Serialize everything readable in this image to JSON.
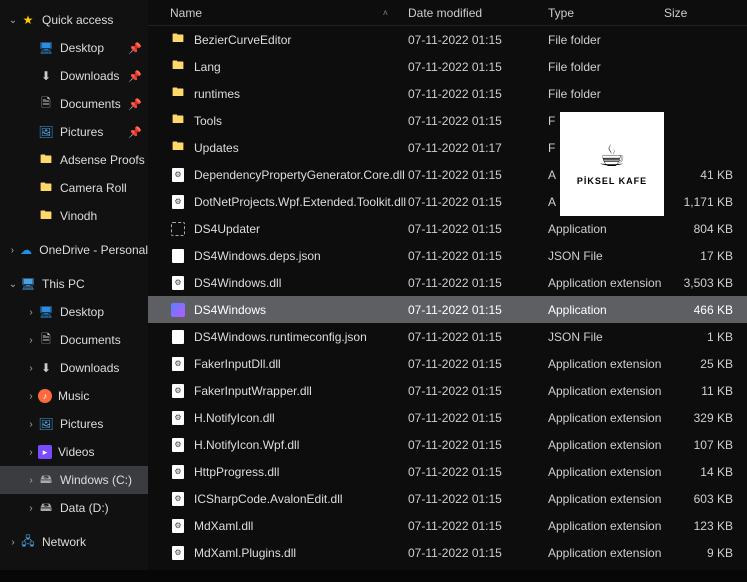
{
  "nav": {
    "quick_access": {
      "label": "Quick access",
      "expanded": true
    },
    "quick_items": [
      {
        "label": "Desktop",
        "pinned": true,
        "icon": "desk"
      },
      {
        "label": "Downloads",
        "pinned": true,
        "icon": "dl"
      },
      {
        "label": "Documents",
        "pinned": true,
        "icon": "doc"
      },
      {
        "label": "Pictures",
        "pinned": true,
        "icon": "pic"
      },
      {
        "label": "Adsense Proofs",
        "pinned": false,
        "icon": "folder"
      },
      {
        "label": "Camera Roll",
        "pinned": false,
        "icon": "folder"
      },
      {
        "label": "Vinodh",
        "pinned": false,
        "icon": "folder"
      }
    ],
    "onedrive": {
      "label": "OneDrive - Personal",
      "expanded": false
    },
    "thispc": {
      "label": "This PC",
      "expanded": true
    },
    "thispc_items": [
      {
        "label": "Desktop",
        "icon": "desk"
      },
      {
        "label": "Documents",
        "icon": "doc"
      },
      {
        "label": "Downloads",
        "icon": "dl"
      },
      {
        "label": "Music",
        "icon": "music"
      },
      {
        "label": "Pictures",
        "icon": "pic2"
      },
      {
        "label": "Videos",
        "icon": "vid"
      },
      {
        "label": "Windows (C:)",
        "icon": "drive",
        "selected": true
      },
      {
        "label": "Data (D:)",
        "icon": "drive"
      }
    ],
    "network": {
      "label": "Network",
      "expanded": false
    }
  },
  "columns": {
    "name": "Name",
    "date": "Date modified",
    "type": "Type",
    "size": "Size"
  },
  "rows": [
    {
      "name": "BezierCurveEditor",
      "date": "07-11-2022 01:15",
      "type": "File folder",
      "size": "",
      "icon": "folder"
    },
    {
      "name": "Lang",
      "date": "07-11-2022 01:15",
      "type": "File folder",
      "size": "",
      "icon": "folder"
    },
    {
      "name": "runtimes",
      "date": "07-11-2022 01:15",
      "type": "File folder",
      "size": "",
      "icon": "folder"
    },
    {
      "name": "Tools",
      "date": "07-11-2022 01:15",
      "type": "F",
      "size": "",
      "icon": "folder"
    },
    {
      "name": "Updates",
      "date": "07-11-2022 01:17",
      "type": "F",
      "size": "",
      "icon": "folder"
    },
    {
      "name": "DependencyPropertyGenerator.Core.dll",
      "date": "07-11-2022 01:15",
      "type": "A",
      "size": "41 KB",
      "icon": "gear"
    },
    {
      "name": "DotNetProjects.Wpf.Extended.Toolkit.dll",
      "date": "07-11-2022 01:15",
      "type": "A",
      "size": "1,171 KB",
      "icon": "gear"
    },
    {
      "name": "DS4Updater",
      "date": "07-11-2022 01:15",
      "type": "Application",
      "size": "804 KB",
      "icon": "upd"
    },
    {
      "name": "DS4Windows.deps.json",
      "date": "07-11-2022 01:15",
      "type": "JSON File",
      "size": "17 KB",
      "icon": "page"
    },
    {
      "name": "DS4Windows.dll",
      "date": "07-11-2022 01:15",
      "type": "Application extension",
      "size": "3,503 KB",
      "icon": "gear"
    },
    {
      "name": "DS4Windows",
      "date": "07-11-2022 01:15",
      "type": "Application",
      "size": "466 KB",
      "icon": "ds4",
      "selected": true
    },
    {
      "name": "DS4Windows.runtimeconfig.json",
      "date": "07-11-2022 01:15",
      "type": "JSON File",
      "size": "1 KB",
      "icon": "page"
    },
    {
      "name": "FakerInputDll.dll",
      "date": "07-11-2022 01:15",
      "type": "Application extension",
      "size": "25 KB",
      "icon": "gear"
    },
    {
      "name": "FakerInputWrapper.dll",
      "date": "07-11-2022 01:15",
      "type": "Application extension",
      "size": "11 KB",
      "icon": "gear"
    },
    {
      "name": "H.NotifyIcon.dll",
      "date": "07-11-2022 01:15",
      "type": "Application extension",
      "size": "329 KB",
      "icon": "gear"
    },
    {
      "name": "H.NotifyIcon.Wpf.dll",
      "date": "07-11-2022 01:15",
      "type": "Application extension",
      "size": "107 KB",
      "icon": "gear"
    },
    {
      "name": "HttpProgress.dll",
      "date": "07-11-2022 01:15",
      "type": "Application extension",
      "size": "14 KB",
      "icon": "gear"
    },
    {
      "name": "ICSharpCode.AvalonEdit.dll",
      "date": "07-11-2022 01:15",
      "type": "Application extension",
      "size": "603 KB",
      "icon": "gear"
    },
    {
      "name": "MdXaml.dll",
      "date": "07-11-2022 01:15",
      "type": "Application extension",
      "size": "123 KB",
      "icon": "gear"
    },
    {
      "name": "MdXaml.Plugins.dll",
      "date": "07-11-2022 01:15",
      "type": "Application extension",
      "size": "9 KB",
      "icon": "gear"
    }
  ],
  "watermark": {
    "text": "PİKSEL KAFE"
  }
}
